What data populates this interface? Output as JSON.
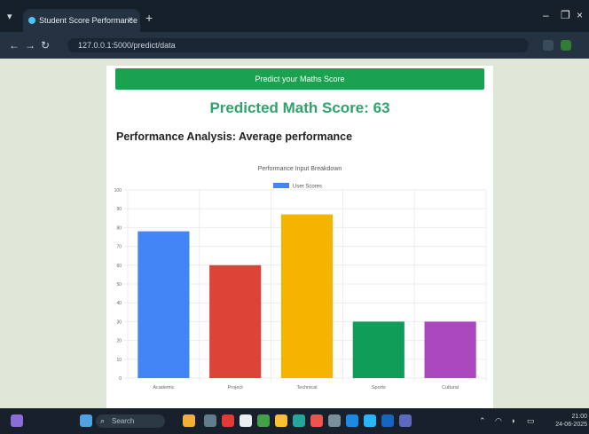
{
  "browser": {
    "tab_title": "Student Score Performance Pr",
    "tab_close": "×",
    "new_tab": "+",
    "url": "127.0.0.1:5000/predict/data",
    "window_controls": [
      "–",
      "❐",
      "×"
    ]
  },
  "page": {
    "predict_button": "Predict your Maths Score",
    "predicted_score": "Predicted Math Score: 63",
    "analysis_heading": "Performance Analysis: Average performance"
  },
  "chart_data": {
    "type": "bar",
    "title": "Performance Input Breakdown",
    "legend": [
      "User Scores"
    ],
    "legend_position": "top-center",
    "categories": [
      "Academic",
      "Project",
      "Technical",
      "Sports",
      "Cultural"
    ],
    "series": [
      {
        "name": "User Scores",
        "values": [
          78,
          60,
          87,
          30,
          30
        ]
      }
    ],
    "colors": [
      "#4285f4",
      "#db4437",
      "#f4b400",
      "#0f9d58",
      "#ab47bc"
    ],
    "legend_color": "#4285f4",
    "ylim": [
      0,
      100
    ],
    "yticks": [
      "0",
      "10",
      "20",
      "30",
      "40",
      "50",
      "60",
      "70",
      "80",
      "90",
      "100"
    ],
    "grid": true
  },
  "taskbar": {
    "search_placeholder": "Search",
    "clock_time": "21:00",
    "clock_date": "24-06-2025"
  }
}
